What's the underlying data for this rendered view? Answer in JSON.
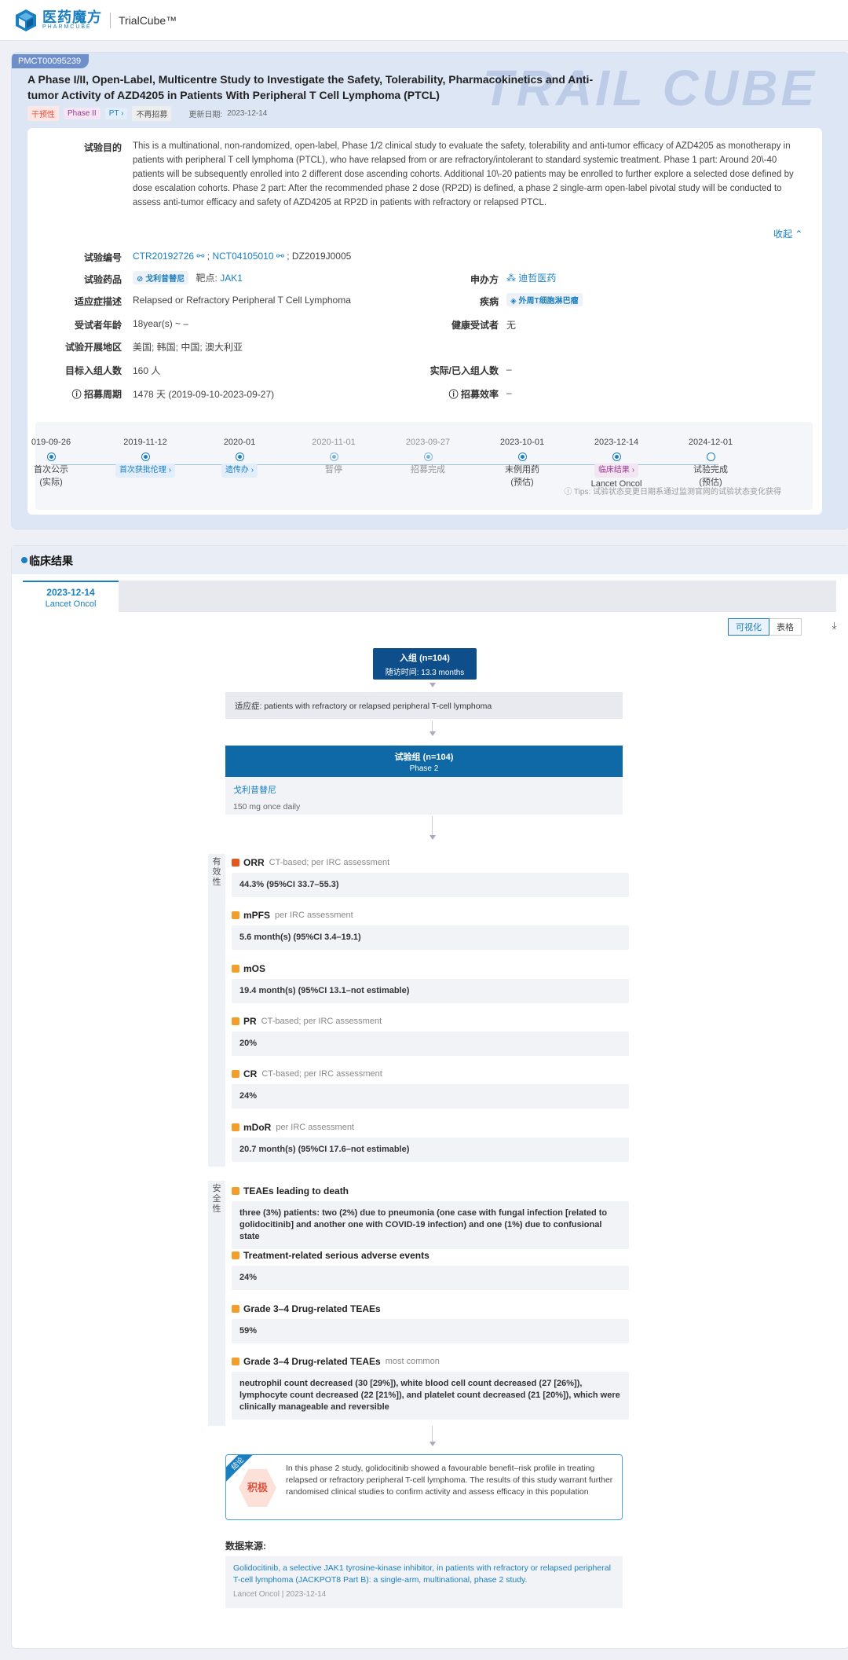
{
  "brand": {
    "cn": "医药魔方",
    "en": "PHARMCUBE",
    "product": "TrialCube™"
  },
  "trial": {
    "id": "PMCT00095239",
    "title": "A Phase I/II, Open-Label, Multicentre Study to Investigate the Safety, Tolerability, Pharmacokinetics and Anti-tumor Activity of AZD4205 in Patients With Peripheral T Cell Lymphoma (PTCL)",
    "tags": [
      "干预性",
      "Phase II",
      "PT",
      "不再招募"
    ],
    "update_label": "更新日期:",
    "update_date": "2023-12-14",
    "purpose_label": "试验目的",
    "purpose": "This is a multinational, non-randomized, open-label, Phase 1/2 clinical study to evaluate the safety, tolerability and anti-tumor efficacy of AZD4205 as monotherapy in patients with peripheral T cell lymphoma (PTCL), who have relapsed from or are refractory/intolerant to standard systemic treatment. Phase 1 part: Around 20\\-40 patients will be subsequently enrolled into 2 different dose ascending cohorts. Additional 10\\-20 patients may be enrolled to further explore a selected dose defined by dose escalation cohorts. Phase 2 part: After the recommended phase 2 dose (RP2D) is defined, a phase 2 single-arm open-label pivotal study will be conducted to assess anti-tumor efficacy and safety of AZD4205 at RP2D in patients with refractory or relapsed PTCL.",
    "collapse": "收起",
    "fields": {
      "number_label": "试验编号",
      "number_ctr": "CTR20192726",
      "number_nct": "NCT04105010",
      "number_other": "; DZ2019J0005",
      "drug_label": "试验药品",
      "drug": "戈利昔替尼",
      "target_label": "靶点:",
      "target": "JAK1",
      "sponsor_label": "申办方",
      "sponsor": "迪哲医药",
      "indication_label": "适应症描述",
      "indication": "Relapsed or Refractory Peripheral T Cell Lymphoma",
      "disease_label": "疾病",
      "disease": "外周T细胞淋巴瘤",
      "age_label": "受试者年龄",
      "age": "18year(s) ~ –",
      "healthy_label": "健康受试者",
      "healthy": "无",
      "region_label": "试验开展地区",
      "region": "美国; 韩国; 中国; 澳大利亚",
      "target_n_label": "目标入组人数",
      "target_n": "160 人",
      "actual_n_label": "实际/已入组人数",
      "actual_n": "–",
      "period_label": "招募周期",
      "period": "1478 天 (2019-09-10-2023-09-27)",
      "efficiency_label": "招募效率",
      "efficiency": "–"
    },
    "timeline": [
      {
        "date": "019-09-26",
        "label": "首次公示",
        "sub": "(实际)",
        "state": "done"
      },
      {
        "date": "2019-11-12",
        "label": "首次获批伦理",
        "sub": "",
        "state": "chip"
      },
      {
        "date": "2020-01",
        "label": "遗传办",
        "sub": "",
        "state": "chip"
      },
      {
        "date": "2020-11-01",
        "label": "暂停",
        "sub": "",
        "state": "muted"
      },
      {
        "date": "2023-09-27",
        "label": "招募完成",
        "sub": "",
        "state": "muted"
      },
      {
        "date": "2023-10-01",
        "label": "末例用药",
        "sub": "(预估)",
        "state": "done"
      },
      {
        "date": "2023-12-14",
        "label": "临床结果",
        "sub": "Lancet Oncol",
        "state": "chip-purple"
      },
      {
        "date": "2024-12-01",
        "label": "试验完成",
        "sub": "(预估)",
        "state": "open"
      }
    ],
    "tips": "Tips: 试验状态变更日期系通过监测官网的试验状态变化获得"
  },
  "results": {
    "section_title": "临床结果",
    "tab_date": "2023-12-14",
    "tab_journal": "Lancet Oncol",
    "view_visual": "可视化",
    "view_table": "表格",
    "enroll_title": "入组 (n=104)",
    "enroll_followup": "随访时间: 13.3 months",
    "indication_label": "适应症:",
    "indication": "patients with refractory or relapsed peripheral T-cell lymphoma",
    "arm_title": "试验组 (n=104)",
    "arm_phase": "Phase 2",
    "arm_drug": "戈利昔替尼",
    "arm_dose": "150 mg once daily",
    "efficacy_label": "有效性",
    "safety_label": "安全性",
    "efficacy": [
      {
        "name": "ORR",
        "note": "CT-based; per IRC assessment",
        "value": "44.3% (95%CI 33.7–55.3)"
      },
      {
        "name": "mPFS",
        "note": "per IRC assessment",
        "value": "5.6 month(s) (95%CI 3.4–19.1)"
      },
      {
        "name": "mOS",
        "note": "",
        "value": "19.4 month(s) (95%CI 13.1–not estimable)"
      },
      {
        "name": "PR",
        "note": "CT-based; per IRC assessment",
        "value": "20%"
      },
      {
        "name": "CR",
        "note": "CT-based; per IRC assessment",
        "value": "24%"
      },
      {
        "name": "mDoR",
        "note": "per IRC assessment",
        "value": "20.7 month(s) (95%CI 17.6–not estimable)"
      }
    ],
    "safety": [
      {
        "name": "TEAEs leading to death",
        "note": "",
        "value": "three (3%) patients: two (2%) due to pneumonia (one case with fungal infection [related to golidocitinib] and another one with COVID-19 infection) and one (1%) due to confusional state"
      },
      {
        "name": "Treatment-related serious adverse events",
        "note": "",
        "value": "24%"
      },
      {
        "name": "Grade 3–4 Drug-related TEAEs",
        "note": "",
        "value": "59%"
      },
      {
        "name": "Grade 3–4 Drug-related TEAEs",
        "note": "most common",
        "value": "neutrophil count decreased (30 [29%]), white blood cell count decreased (27 [26%]), lymphocyte count decreased (22 [21%]), and platelet count decreased (21 [20%]), which were clinically manageable and reversible"
      }
    ],
    "conclusion_tag": "结论",
    "conclusion_badge": "积极",
    "conclusion": "In this phase 2 study, golidocitinib showed a favourable benefit–risk profile in treating relapsed or refractory peripheral T-cell lymphoma. The results of this study warrant further randomised clinical studies to confirm activity and assess efficacy in this population",
    "source_label": "数据来源:",
    "source_title": "Golidocitinib, a selective JAK1 tyrosine-kinase inhibitor, in patients with refractory or relapsed peripheral T-cell lymphoma (JACKPOT8 Part B): a single-arm, multinational, phase 2 study.",
    "source_journal": "Lancet Oncol",
    "source_date": "2023-12-14"
  },
  "colors": {
    "accent": "#1a7fc0",
    "navy": "#0e4e8a",
    "arm": "#0e69a6",
    "orange": "#f29e2a"
  }
}
